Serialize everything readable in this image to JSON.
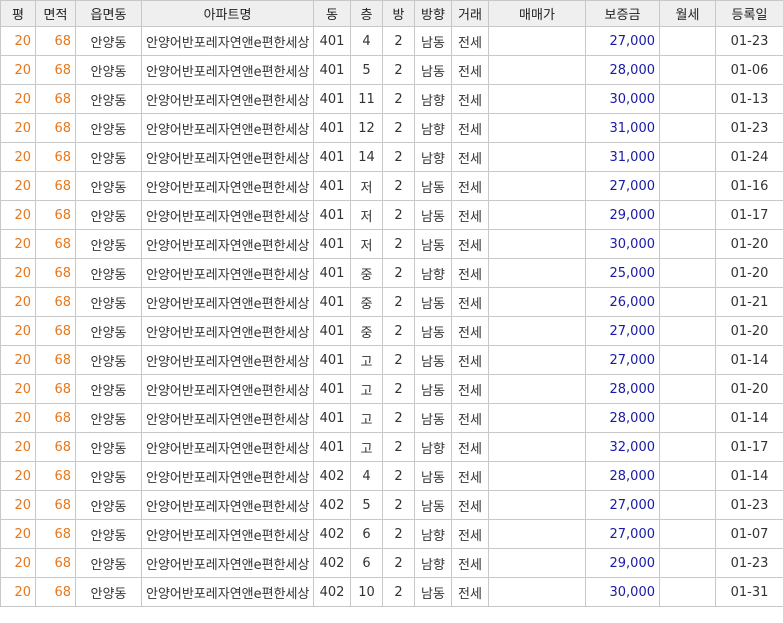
{
  "table": {
    "headers": [
      "평",
      "면적",
      "읍면동",
      "아파트명",
      "동",
      "층",
      "방",
      "방향",
      "거래",
      "매매가",
      "보증금",
      "월세",
      "등록일"
    ],
    "rows": [
      {
        "pyeong": "20",
        "area": "68",
        "dong_name": "안양동",
        "apt": "안양어반포레자연앤e편한세상",
        "bldg": "401",
        "floor": "4",
        "rooms": "2",
        "dir": "남동",
        "deal": "전세",
        "price": "",
        "deposit": "27,000",
        "rent": "",
        "date": "01-23"
      },
      {
        "pyeong": "20",
        "area": "68",
        "dong_name": "안양동",
        "apt": "안양어반포레자연앤e편한세상",
        "bldg": "401",
        "floor": "5",
        "rooms": "2",
        "dir": "남동",
        "deal": "전세",
        "price": "",
        "deposit": "28,000",
        "rent": "",
        "date": "01-06"
      },
      {
        "pyeong": "20",
        "area": "68",
        "dong_name": "안양동",
        "apt": "안양어반포레자연앤e편한세상",
        "bldg": "401",
        "floor": "11",
        "rooms": "2",
        "dir": "남향",
        "deal": "전세",
        "price": "",
        "deposit": "30,000",
        "rent": "",
        "date": "01-13"
      },
      {
        "pyeong": "20",
        "area": "68",
        "dong_name": "안양동",
        "apt": "안양어반포레자연앤e편한세상",
        "bldg": "401",
        "floor": "12",
        "rooms": "2",
        "dir": "남향",
        "deal": "전세",
        "price": "",
        "deposit": "31,000",
        "rent": "",
        "date": "01-23"
      },
      {
        "pyeong": "20",
        "area": "68",
        "dong_name": "안양동",
        "apt": "안양어반포레자연앤e편한세상",
        "bldg": "401",
        "floor": "14",
        "rooms": "2",
        "dir": "남향",
        "deal": "전세",
        "price": "",
        "deposit": "31,000",
        "rent": "",
        "date": "01-24"
      },
      {
        "pyeong": "20",
        "area": "68",
        "dong_name": "안양동",
        "apt": "안양어반포레자연앤e편한세상",
        "bldg": "401",
        "floor": "저",
        "rooms": "2",
        "dir": "남동",
        "deal": "전세",
        "price": "",
        "deposit": "27,000",
        "rent": "",
        "date": "01-16"
      },
      {
        "pyeong": "20",
        "area": "68",
        "dong_name": "안양동",
        "apt": "안양어반포레자연앤e편한세상",
        "bldg": "401",
        "floor": "저",
        "rooms": "2",
        "dir": "남동",
        "deal": "전세",
        "price": "",
        "deposit": "29,000",
        "rent": "",
        "date": "01-17"
      },
      {
        "pyeong": "20",
        "area": "68",
        "dong_name": "안양동",
        "apt": "안양어반포레자연앤e편한세상",
        "bldg": "401",
        "floor": "저",
        "rooms": "2",
        "dir": "남동",
        "deal": "전세",
        "price": "",
        "deposit": "30,000",
        "rent": "",
        "date": "01-20"
      },
      {
        "pyeong": "20",
        "area": "68",
        "dong_name": "안양동",
        "apt": "안양어반포레자연앤e편한세상",
        "bldg": "401",
        "floor": "중",
        "rooms": "2",
        "dir": "남향",
        "deal": "전세",
        "price": "",
        "deposit": "25,000",
        "rent": "",
        "date": "01-20"
      },
      {
        "pyeong": "20",
        "area": "68",
        "dong_name": "안양동",
        "apt": "안양어반포레자연앤e편한세상",
        "bldg": "401",
        "floor": "중",
        "rooms": "2",
        "dir": "남동",
        "deal": "전세",
        "price": "",
        "deposit": "26,000",
        "rent": "",
        "date": "01-21"
      },
      {
        "pyeong": "20",
        "area": "68",
        "dong_name": "안양동",
        "apt": "안양어반포레자연앤e편한세상",
        "bldg": "401",
        "floor": "중",
        "rooms": "2",
        "dir": "남동",
        "deal": "전세",
        "price": "",
        "deposit": "27,000",
        "rent": "",
        "date": "01-20"
      },
      {
        "pyeong": "20",
        "area": "68",
        "dong_name": "안양동",
        "apt": "안양어반포레자연앤e편한세상",
        "bldg": "401",
        "floor": "고",
        "rooms": "2",
        "dir": "남동",
        "deal": "전세",
        "price": "",
        "deposit": "27,000",
        "rent": "",
        "date": "01-14"
      },
      {
        "pyeong": "20",
        "area": "68",
        "dong_name": "안양동",
        "apt": "안양어반포레자연앤e편한세상",
        "bldg": "401",
        "floor": "고",
        "rooms": "2",
        "dir": "남동",
        "deal": "전세",
        "price": "",
        "deposit": "28,000",
        "rent": "",
        "date": "01-20"
      },
      {
        "pyeong": "20",
        "area": "68",
        "dong_name": "안양동",
        "apt": "안양어반포레자연앤e편한세상",
        "bldg": "401",
        "floor": "고",
        "rooms": "2",
        "dir": "남동",
        "deal": "전세",
        "price": "",
        "deposit": "28,000",
        "rent": "",
        "date": "01-14"
      },
      {
        "pyeong": "20",
        "area": "68",
        "dong_name": "안양동",
        "apt": "안양어반포레자연앤e편한세상",
        "bldg": "401",
        "floor": "고",
        "rooms": "2",
        "dir": "남향",
        "deal": "전세",
        "price": "",
        "deposit": "32,000",
        "rent": "",
        "date": "01-17"
      },
      {
        "pyeong": "20",
        "area": "68",
        "dong_name": "안양동",
        "apt": "안양어반포레자연앤e편한세상",
        "bldg": "402",
        "floor": "4",
        "rooms": "2",
        "dir": "남동",
        "deal": "전세",
        "price": "",
        "deposit": "28,000",
        "rent": "",
        "date": "01-14"
      },
      {
        "pyeong": "20",
        "area": "68",
        "dong_name": "안양동",
        "apt": "안양어반포레자연앤e편한세상",
        "bldg": "402",
        "floor": "5",
        "rooms": "2",
        "dir": "남동",
        "deal": "전세",
        "price": "",
        "deposit": "27,000",
        "rent": "",
        "date": "01-23"
      },
      {
        "pyeong": "20",
        "area": "68",
        "dong_name": "안양동",
        "apt": "안양어반포레자연앤e편한세상",
        "bldg": "402",
        "floor": "6",
        "rooms": "2",
        "dir": "남향",
        "deal": "전세",
        "price": "",
        "deposit": "27,000",
        "rent": "",
        "date": "01-07"
      },
      {
        "pyeong": "20",
        "area": "68",
        "dong_name": "안양동",
        "apt": "안양어반포레자연앤e편한세상",
        "bldg": "402",
        "floor": "6",
        "rooms": "2",
        "dir": "남향",
        "deal": "전세",
        "price": "",
        "deposit": "29,000",
        "rent": "",
        "date": "01-23"
      },
      {
        "pyeong": "20",
        "area": "68",
        "dong_name": "안양동",
        "apt": "안양어반포레자연앤e편한세상",
        "bldg": "402",
        "floor": "10",
        "rooms": "2",
        "dir": "남동",
        "deal": "전세",
        "price": "",
        "deposit": "30,000",
        "rent": "",
        "date": "01-31"
      }
    ]
  },
  "colors": {
    "pyeong_area": "#e8761a",
    "deposit": "#1a1aa6",
    "header_bg": "#efefef",
    "border": "#c8c8c8"
  }
}
